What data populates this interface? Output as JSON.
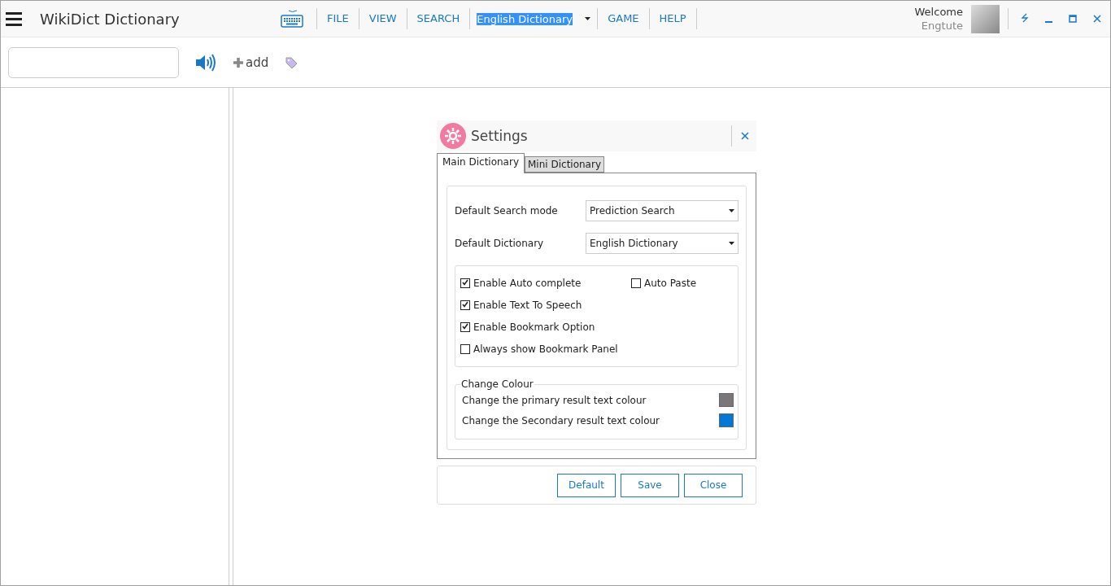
{
  "app": {
    "title": "WikiDict Dictionary"
  },
  "menu": [
    {
      "label": "FILE"
    },
    {
      "label": "VIEW"
    },
    {
      "label": "SEARCH"
    }
  ],
  "dictionary_select": {
    "value": "English Dictionary",
    "selected": true
  },
  "menu_right": [
    {
      "label": "GAME"
    },
    {
      "label": "HELP"
    }
  ],
  "user": {
    "greeting": "Welcome",
    "name": "Engtute"
  },
  "toolbar": {
    "add_label": "add"
  },
  "dialog": {
    "title": "Settings",
    "tabs": [
      {
        "label": "Main Dictionary",
        "selected": true
      },
      {
        "label": "Mini Dictionary",
        "selected": false
      }
    ],
    "fields": [
      {
        "label": "Default Search mode",
        "value": "Prediction Search"
      },
      {
        "label": "Default Dictionary",
        "value": "English Dictionary"
      }
    ],
    "options": [
      {
        "label": "Enable Auto complete",
        "checked": true
      },
      {
        "label": "Auto Paste",
        "checked": false
      },
      {
        "label": "Enable Text To Speech",
        "checked": true
      },
      {
        "label": "Enable Bookmark Option",
        "checked": true
      },
      {
        "label": "Always show Bookmark Panel",
        "checked": false
      }
    ],
    "colour_group": {
      "legend": "Change Colour",
      "rows": [
        {
          "label": "Change the primary result text colour",
          "color": "#7a767a"
        },
        {
          "label": "Change the Secondary result text colour",
          "color": "#0078d7"
        }
      ]
    },
    "buttons": [
      "Default",
      "Save",
      "Close"
    ]
  }
}
